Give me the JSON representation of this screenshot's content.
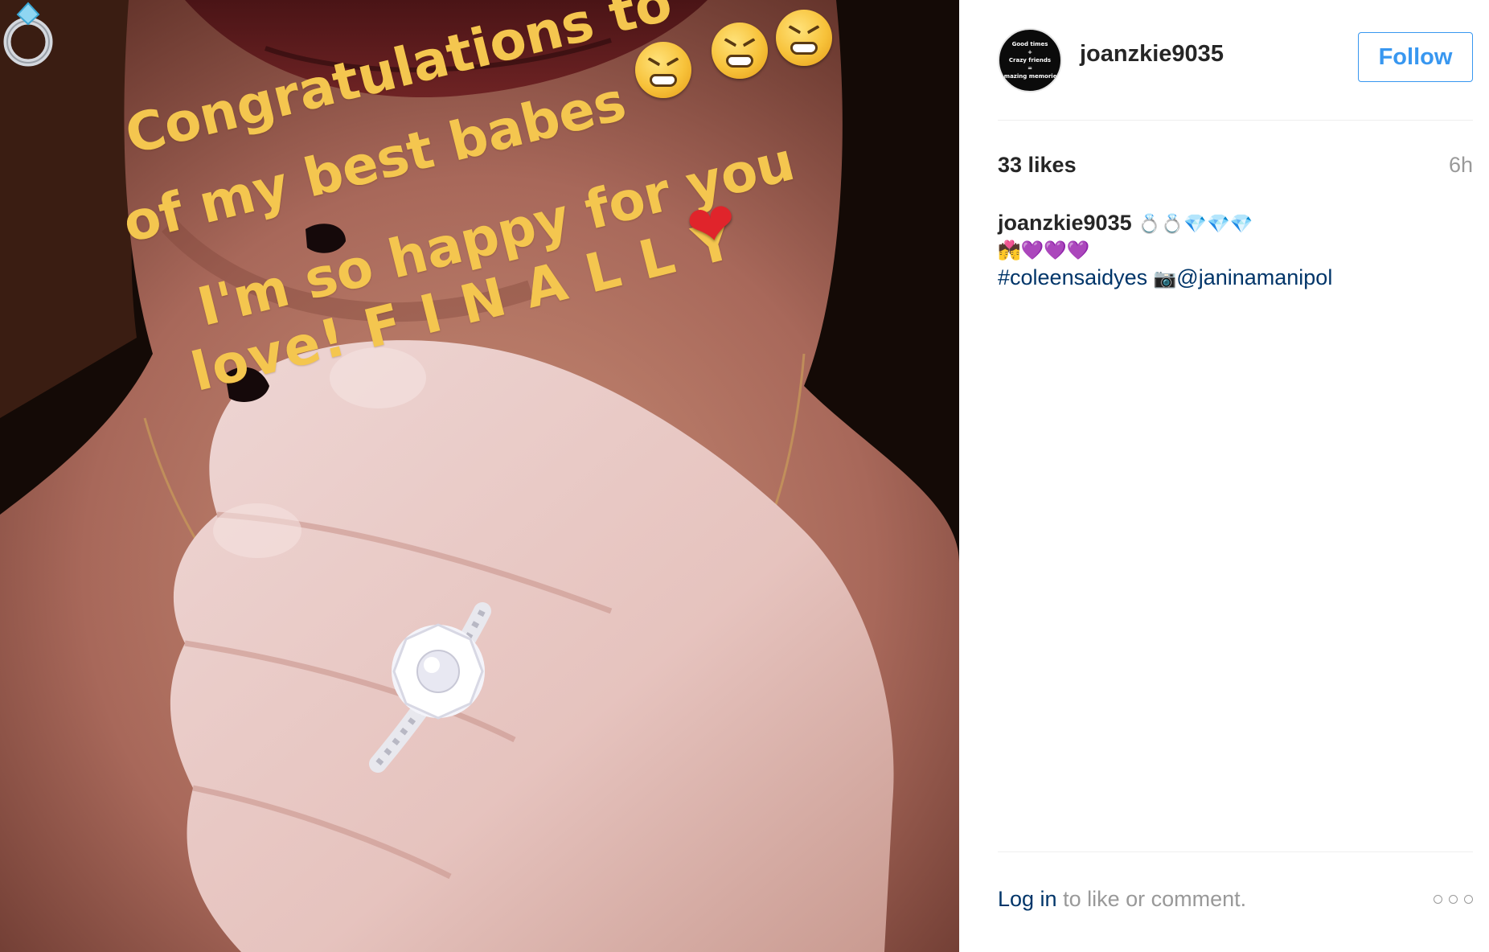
{
  "photo": {
    "caption_lines": [
      "Congratulations to",
      "of my best babes",
      "I'm so happy for you",
      "love! F I N A L L Y"
    ],
    "emoji": {
      "tired": "tired-face-emoji",
      "heart": "❤",
      "ring": "ring-emoji"
    },
    "caption_color": "#f4c64f"
  },
  "header": {
    "avatar_text": [
      "Good times",
      "+",
      "Crazy friends",
      "=",
      "Amazing memories"
    ],
    "username": "joanzkie9035",
    "follow_label": "Follow"
  },
  "stats": {
    "likes": "33 likes",
    "time": "6h"
  },
  "comment": {
    "author": "joanzkie9035",
    "emoji_line1": "💍💍💎💎💎",
    "emoji_line2": "💏💜💜💜",
    "hashtag": "#coleensaidyes",
    "camera": "📷",
    "mention": "@janinamanipol"
  },
  "footer": {
    "login_link": "Log in",
    "login_rest": " to like or comment.",
    "more_icon": "more-options-icon"
  },
  "colors": {
    "link": "#003569",
    "button": "#3897f0",
    "muted": "#999999"
  }
}
